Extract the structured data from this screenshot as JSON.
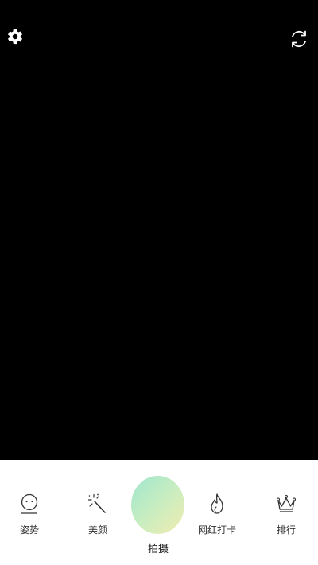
{
  "top_bar": {
    "settings_icon": "gear-icon",
    "flip_icon": "camera-switch-icon"
  },
  "tools": {
    "pose": {
      "label": "姿势",
      "icon": "face-icon"
    },
    "beauty": {
      "label": "美颜",
      "icon": "magic-wand-icon"
    },
    "checkin": {
      "label": "网红打卡",
      "icon": "flame-icon"
    },
    "rank": {
      "label": "排行",
      "icon": "crown-icon"
    }
  },
  "shutter": {
    "label": "拍摄",
    "gradient_colors": [
      "#9fe6cf",
      "#f1ecb0"
    ]
  },
  "colors": {
    "viewfinder_bg": "#000000",
    "bottom_bar_bg": "#ffffff",
    "icon_stroke": "#333333"
  }
}
